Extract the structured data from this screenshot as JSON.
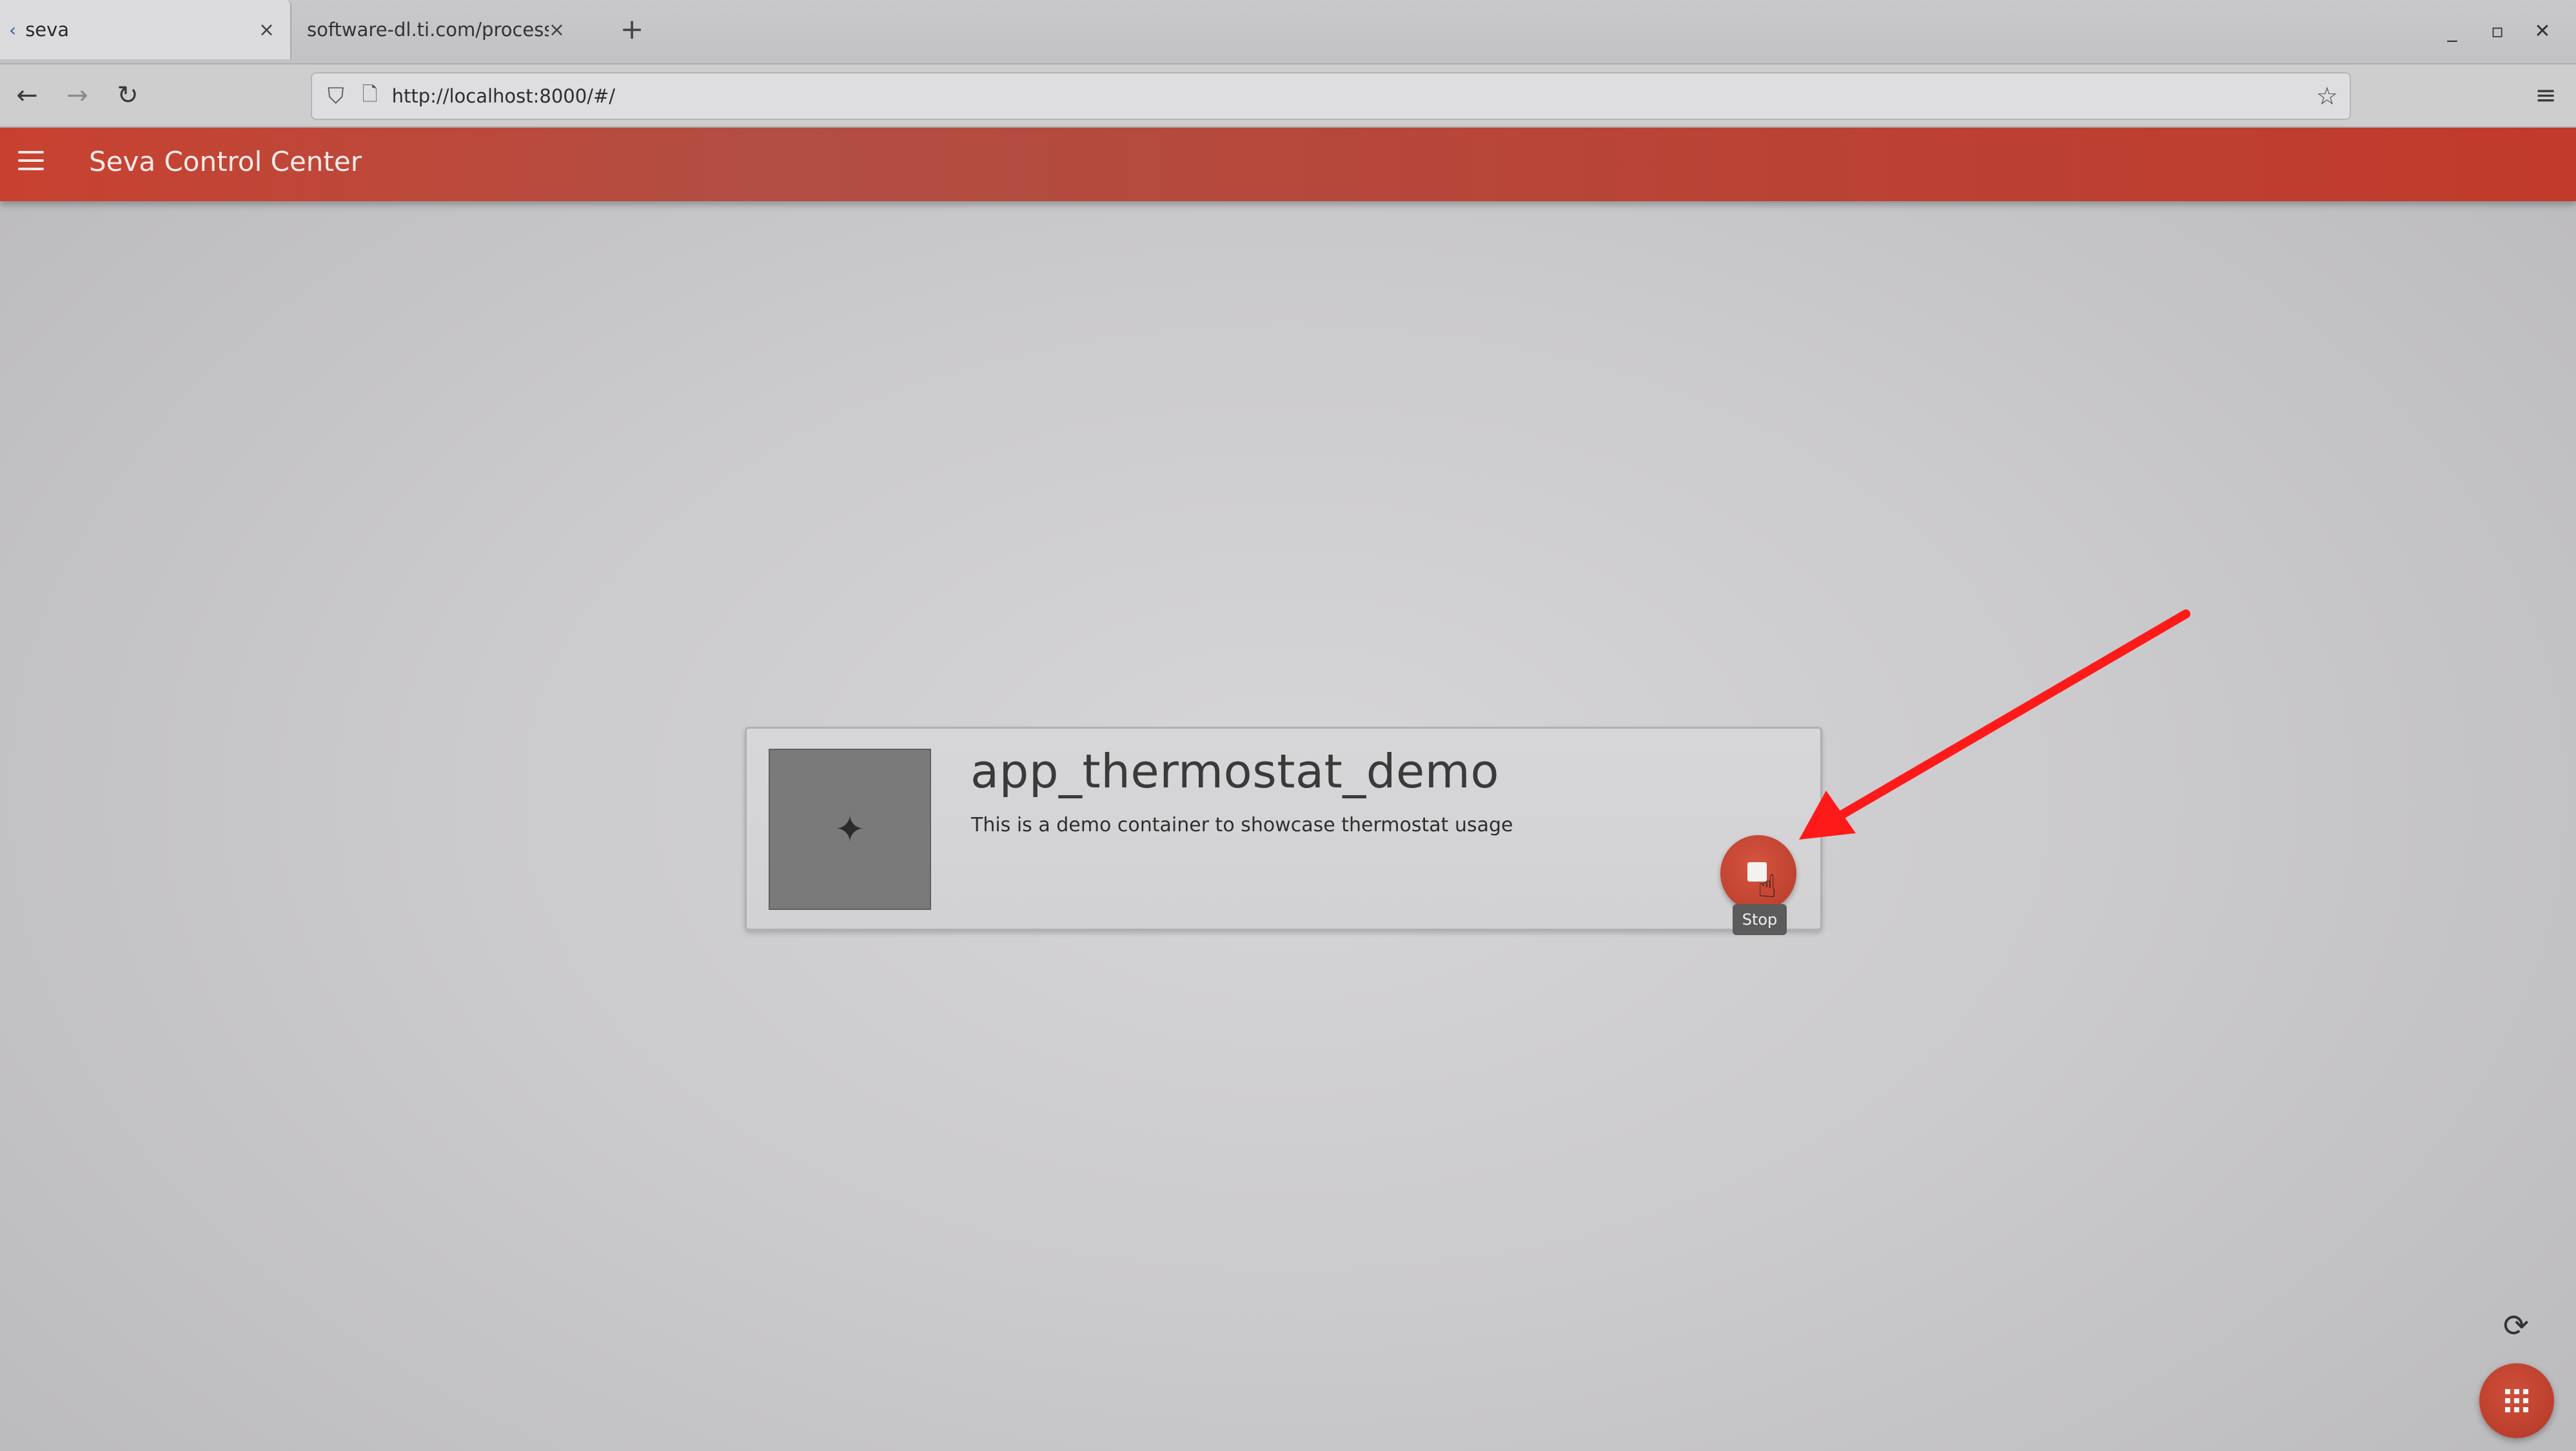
{
  "browser": {
    "tabs": [
      {
        "label": "seva",
        "close": "×",
        "active": true
      },
      {
        "label": "software-dl.ti.com/processor-s",
        "close": "×",
        "active": false
      }
    ],
    "new_tab": "+",
    "window_controls": {
      "minimize": "_",
      "maximize": "▫",
      "close": "✕"
    },
    "nav": {
      "back": "←",
      "forward": "→",
      "reload": "↻",
      "menu": "≡"
    },
    "url": "http://localhost:8000/#/",
    "bookmark": "☆"
  },
  "app": {
    "title": "Seva Control Center",
    "accent_color": "#c0392b"
  },
  "card": {
    "title": "app_thermostat_demo",
    "description": "This is a demo container to showcase thermostat usage",
    "action_tooltip": "Stop"
  },
  "icons": {
    "thumbnail": "sparkle-icon",
    "action": "stop-icon",
    "refresh": "refresh-icon",
    "fab": "apps-grid-icon"
  },
  "annotation": {
    "color": "#ff1a1a"
  }
}
